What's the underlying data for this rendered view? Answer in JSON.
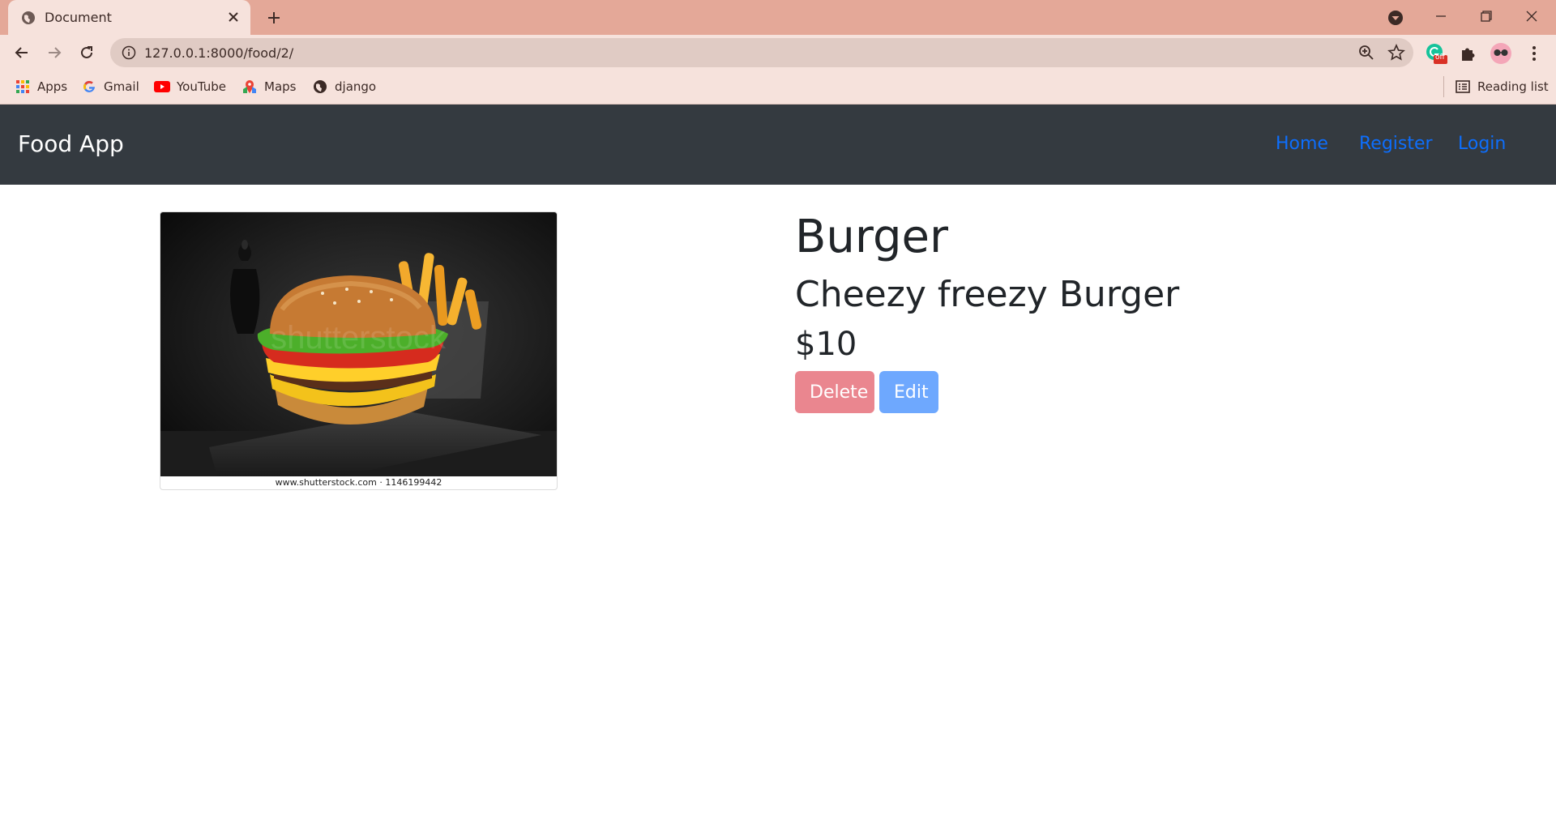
{
  "browser": {
    "tab_title": "Document",
    "url": "127.0.0.1:8000/food/2/",
    "bookmarks": [
      {
        "label": "Apps",
        "icon": "apps-grid-icon"
      },
      {
        "label": "Gmail",
        "icon": "google-icon"
      },
      {
        "label": "YouTube",
        "icon": "youtube-icon"
      },
      {
        "label": "Maps",
        "icon": "maps-icon"
      },
      {
        "label": "django",
        "icon": "globe-icon"
      }
    ],
    "reading_list": "Reading list",
    "extension_badge": "off",
    "colors": {
      "tabstrip": "#e4a898",
      "toolbar": "#f6e2dc",
      "omnibox": "#e0cbc4"
    }
  },
  "navbar": {
    "brand": "Food App",
    "links": [
      "Home",
      "Register",
      "Login"
    ],
    "colors": {
      "background": "#343a40",
      "link": "#0d6efd"
    }
  },
  "food": {
    "name": "Burger",
    "description": "Cheezy freezy Burger",
    "price": "$10",
    "image_caption": "www.shutterstock.com · 1146199442",
    "image_watermark": "shutterstock"
  },
  "actions": {
    "delete_label": "Delete",
    "edit_label": "Edit",
    "colors": {
      "delete": "#ea868f",
      "edit": "#6ea8fe"
    }
  }
}
